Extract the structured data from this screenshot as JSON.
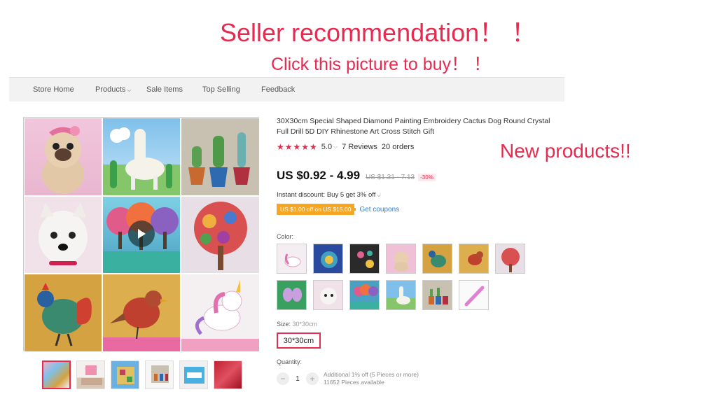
{
  "promo": {
    "title": "Seller recommendation！ ！",
    "subtitle": "Click this picture to buy！ ！",
    "new_products": "New products!!"
  },
  "nav": {
    "items": [
      "Store Home",
      "Products",
      "Sale Items",
      "Top Selling",
      "Feedback"
    ]
  },
  "product": {
    "title": "30X30cm Special Shaped Diamond Painting Embroidery Cactus Dog Round Crystal Full Drill 5D DIY Rhinestone Art Cross Stitch Gift",
    "rating": "5.0",
    "reviews": "7 Reviews",
    "orders": "20 orders",
    "price": "US $0.92 - 4.99",
    "old_price": "US $1.31 - 7.13",
    "discount": "-30%",
    "instant_discount": "Instant discount: Buy 5 get 3% off",
    "coupon": "US $1.00 off on US $15.00",
    "coupon_link": "Get coupons",
    "color_label": "Color:",
    "size_label": "Size:",
    "size_value": "30*30cm",
    "size_option": "30*30cm",
    "quantity_label": "Quantity:",
    "quantity": "1",
    "qty_note1": "Additional 1% off (5 Pieces or more)",
    "qty_note2": "11652 Pieces available"
  },
  "icons": {
    "play": "play-icon",
    "chevron": "chevron-down-icon",
    "star": "star-icon"
  },
  "colors": {
    "accent": "#e62a50",
    "link": "#2a7fd4",
    "coupon": "#f5a623"
  }
}
